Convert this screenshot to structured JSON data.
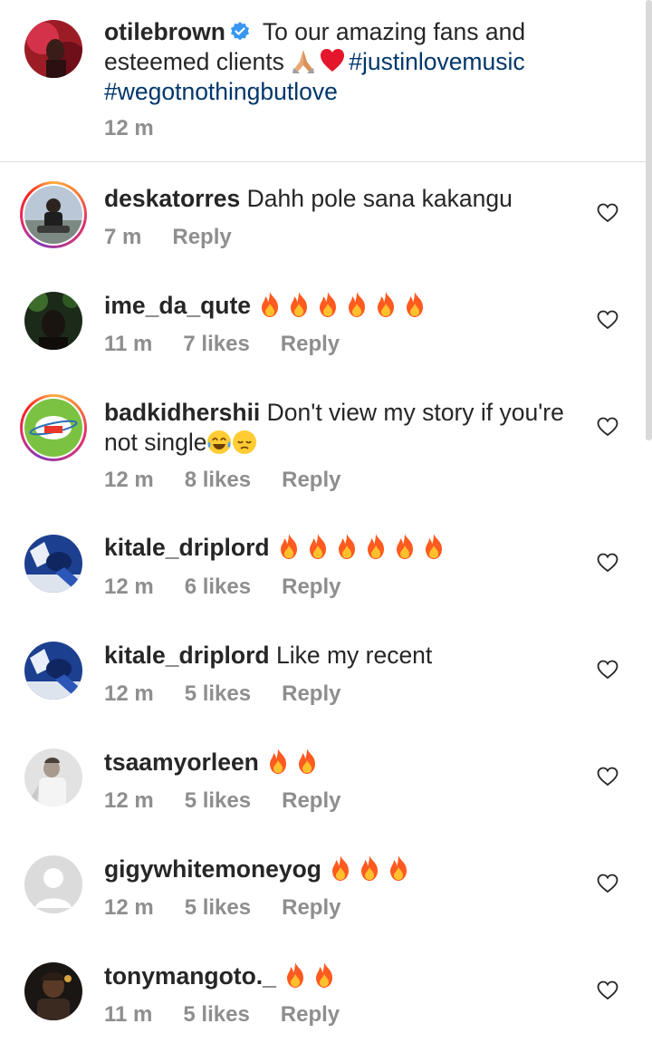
{
  "post": {
    "username": "otilebrown",
    "caption_text": " To our amazing fans and esteemed clients ",
    "hashtags": [
      "#justinlovemusic",
      "#wegotnothingbutlove"
    ],
    "time": "12 m",
    "emoji": [
      "folded-hands",
      "red-heart"
    ]
  },
  "comments": [
    {
      "username": "deskatorres",
      "text": " Dahh pole sana kakangu",
      "time": "7 m",
      "likes": "",
      "reply": "Reply",
      "emoji": [],
      "has_story_ring": true
    },
    {
      "username": "ime_da_qute",
      "text": " ",
      "time": "11 m",
      "likes": "7 likes",
      "reply": "Reply",
      "emoji": [
        "fire",
        "fire",
        "fire",
        "fire",
        "fire",
        "fire"
      ],
      "has_story_ring": false
    },
    {
      "username": "badkidhershii",
      "text": " Don't view my story if you're not single",
      "time": "12 m",
      "likes": "8 likes",
      "reply": "Reply",
      "emoji": [
        "joy-face",
        "pensive-face"
      ],
      "has_story_ring": true
    },
    {
      "username": "kitale_driplord",
      "text": " ",
      "time": "12 m",
      "likes": "6 likes",
      "reply": "Reply",
      "emoji": [
        "fire",
        "fire",
        "fire",
        "fire",
        "fire",
        "fire"
      ],
      "has_story_ring": false
    },
    {
      "username": "kitale_driplord",
      "text": " Like my recent",
      "time": "12 m",
      "likes": "5 likes",
      "reply": "Reply",
      "emoji": [],
      "has_story_ring": false
    },
    {
      "username": "tsaamyorleen",
      "text": " ",
      "time": "12 m",
      "likes": "5 likes",
      "reply": "Reply",
      "emoji": [
        "fire",
        "fire"
      ],
      "has_story_ring": false
    },
    {
      "username": "gigywhitemoneyog",
      "text": " ",
      "time": "12 m",
      "likes": "5 likes",
      "reply": "Reply",
      "emoji": [
        "fire",
        "fire",
        "fire"
      ],
      "has_story_ring": false
    },
    {
      "username": "tonymangoto._",
      "text": " ",
      "time": "11 m",
      "likes": "5 likes",
      "reply": "Reply",
      "emoji": [
        "fire",
        "fire"
      ],
      "has_story_ring": false
    }
  ],
  "colors": {
    "text": "#262626",
    "meta": "#8e8e8e",
    "hashtag": "#00376b",
    "verified": "#3897f0",
    "fire": "#ff5a1f"
  }
}
